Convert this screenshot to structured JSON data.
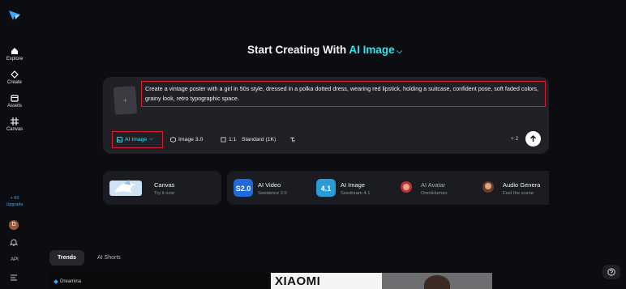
{
  "sidebar": {
    "items": [
      {
        "label": "Explore"
      },
      {
        "label": "Create"
      },
      {
        "label": "Assets"
      },
      {
        "label": "Canvas"
      }
    ],
    "upgrade_count": "+ 60",
    "upgrade_label": "Upgrade",
    "avatar_initial": "D",
    "api_label": "API"
  },
  "heading": {
    "prefix": "Start Creating With",
    "mode": "AI Image"
  },
  "composer": {
    "prompt": "Create a vintage poster with a girl in 50s style, dressed in a polka dotted dress, wearing red lipstick, holding a suitcase, confident pose, soft faded colors, grainy look, retro typographic space.",
    "reference_add": "+",
    "tools": {
      "mode": "AI Image",
      "model": "Image 3.0",
      "ratio": "1:1",
      "quality": "Standard (1K)"
    },
    "credits": "+ 2"
  },
  "cards": [
    {
      "title": "Canvas",
      "subtitle": "Try it now"
    },
    {
      "title": "AI Video",
      "subtitle": "Seedance 2.0"
    },
    {
      "title": "AI Image",
      "subtitle": "Seedream 4.1"
    },
    {
      "title": "AI Avatar",
      "subtitle": "OmniHuman"
    },
    {
      "title": "Audio Genera",
      "subtitle": "Feel the scene"
    }
  ],
  "tabs": [
    {
      "label": "Trends"
    },
    {
      "label": "AI Shorts"
    }
  ],
  "gallery": {
    "brand": "Dreamina",
    "headline": "XIAOMI"
  },
  "colors": {
    "accent": "#2ee6f0",
    "highlight_border": "#d81e2c",
    "background": "#0c0d10",
    "panel": "#1f2127"
  }
}
